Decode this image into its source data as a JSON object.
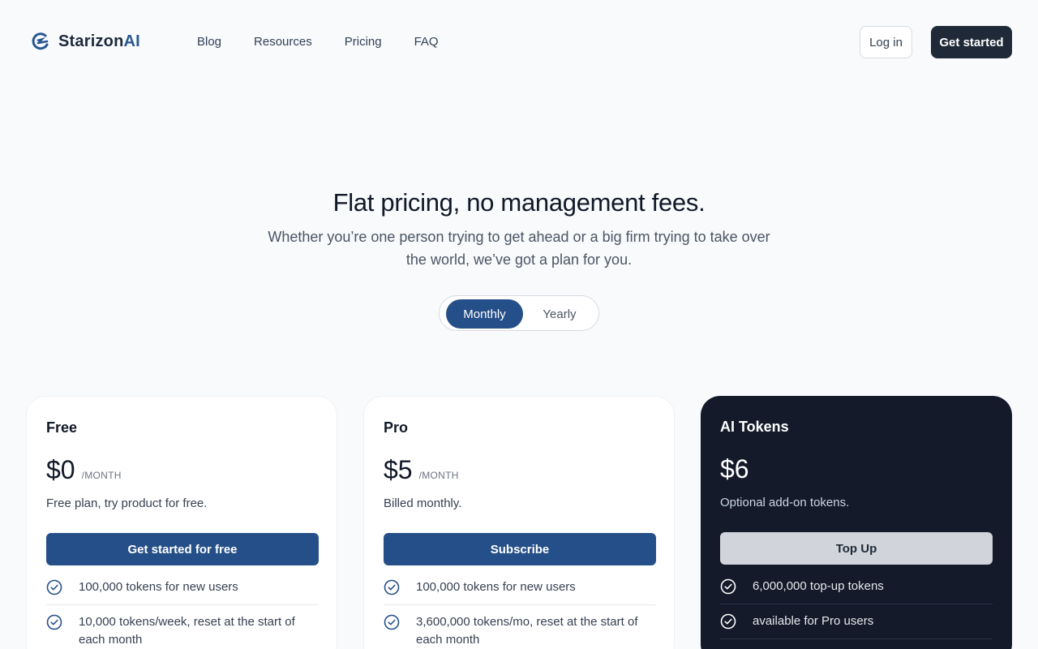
{
  "brand": {
    "name_main": "Starizon",
    "name_accent": "AI",
    "accent_color": "#2a5693"
  },
  "nav": {
    "items": [
      "Blog",
      "Resources",
      "Pricing",
      "FAQ"
    ]
  },
  "header": {
    "login_label": "Log in",
    "get_started_label": "Get started"
  },
  "hero": {
    "title": "Flat pricing, no management fees.",
    "subtitle": "Whether you’re one person trying to get ahead or a big firm trying to take over the world, we’ve got a plan for you."
  },
  "billing_toggle": {
    "options": [
      "Monthly",
      "Yearly"
    ],
    "selected": "Monthly"
  },
  "plans": [
    {
      "name": "Free",
      "price": "$0",
      "period": "/MONTH",
      "description": "Free plan, try product for free.",
      "cta": "Get started for free",
      "features": [
        "100,000 tokens for new users",
        "10,000 tokens/week, reset at the start of each month"
      ]
    },
    {
      "name": "Pro",
      "price": "$5",
      "period": "/MONTH",
      "description": "Billed monthly.",
      "cta": "Subscribe",
      "features": [
        "100,000 tokens for new users",
        "3,600,000 tokens/mo, reset at the start of each month"
      ]
    },
    {
      "name": "AI Tokens",
      "price": "$6",
      "period": "",
      "description": "Optional add-on tokens.",
      "cta": "Top Up",
      "features": [
        "6,000,000 top-up tokens",
        "available for Pro users"
      ]
    }
  ],
  "icons": {
    "feature": "check-circle-icon",
    "logo": "starizon-logo-icon"
  },
  "colors": {
    "primary": "#254f88",
    "dark_card": "#141a2a",
    "dark_button": "#1f2937"
  }
}
